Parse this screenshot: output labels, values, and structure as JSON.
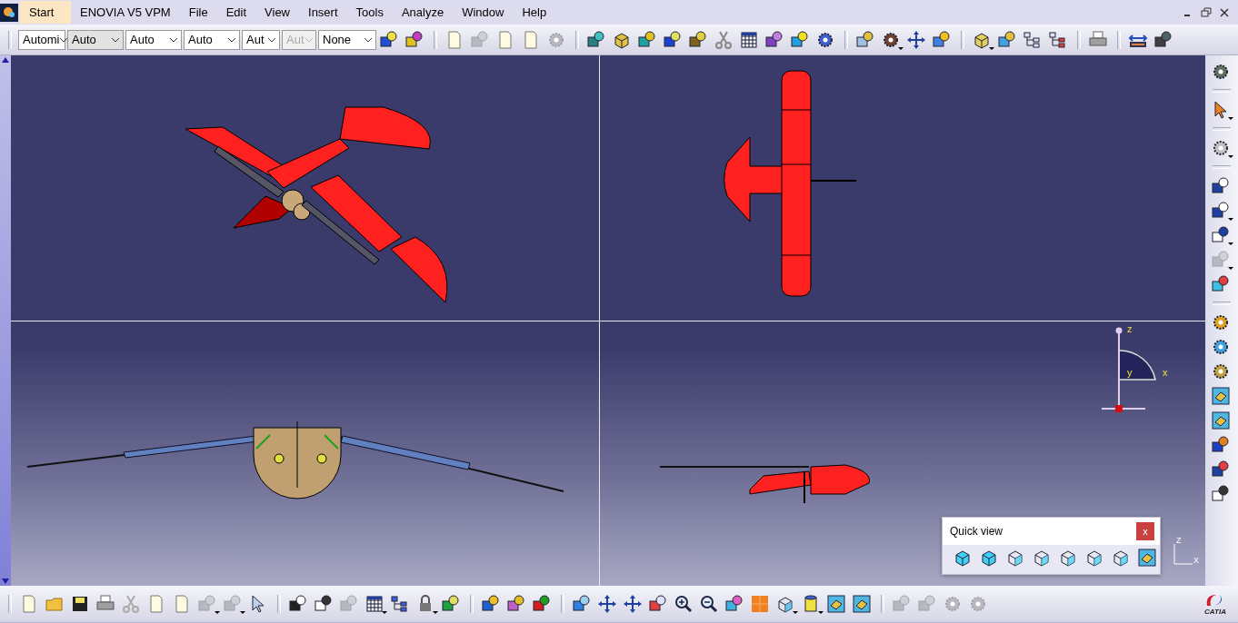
{
  "menu_bar": {
    "items": [
      {
        "label": "Start",
        "selected": true
      },
      {
        "label": "ENOVIA V5 VPM",
        "selected": false
      },
      {
        "label": "File",
        "selected": false
      },
      {
        "label": "Edit",
        "selected": false
      },
      {
        "label": "View",
        "selected": false
      },
      {
        "label": "Insert",
        "selected": false
      },
      {
        "label": "Tools",
        "selected": false
      },
      {
        "label": "Analyze",
        "selected": false
      },
      {
        "label": "Window",
        "selected": false
      },
      {
        "label": "Help",
        "selected": false
      }
    ]
  },
  "graphic_properties": {
    "combos": [
      {
        "value": "Automi",
        "disabled": false
      },
      {
        "value": "Auto",
        "disabled": false
      },
      {
        "value": "Auto",
        "disabled": false
      },
      {
        "value": "Auto",
        "disabled": false
      },
      {
        "value": "Aut",
        "disabled": false
      },
      {
        "value": "Aut",
        "disabled": true
      },
      {
        "value": "None",
        "disabled": false
      }
    ]
  },
  "compass": {
    "axes": [
      "z",
      "y",
      "x"
    ]
  },
  "axis_triad": {
    "labels": [
      "Z",
      "X"
    ]
  },
  "quick_view": {
    "title": "Quick view",
    "close": "x"
  },
  "logo": {
    "text": "CATIA"
  }
}
